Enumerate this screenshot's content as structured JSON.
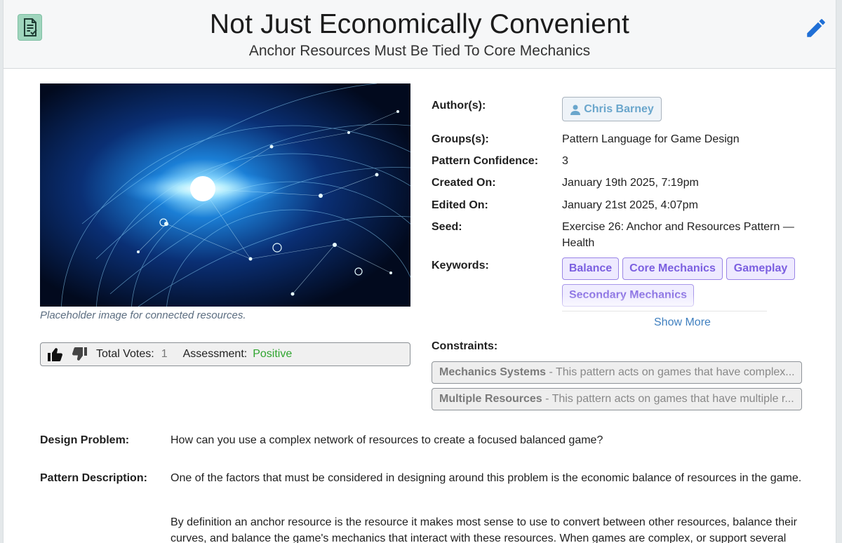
{
  "header": {
    "title": "Not Just Economically Convenient",
    "subtitle": "Anchor Resources Must Be Tied To Core Mechanics",
    "doc_icon": "document-check-icon",
    "edit_icon": "pencil-icon"
  },
  "image": {
    "caption": "Placeholder image for connected resources."
  },
  "votes": {
    "total_label": "Total Votes:",
    "total_value": "1",
    "assessment_label": "Assessment:",
    "assessment_value": "Positive"
  },
  "meta": {
    "authors_label": "Author(s):",
    "author_name": "Chris Barney",
    "groups_label": "Groups(s):",
    "groups_value": "Pattern Language for Game Design",
    "confidence_label": "Pattern Confidence:",
    "confidence_value": "3",
    "created_label": "Created On:",
    "created_value": "January 19th 2025, 7:19pm",
    "edited_label": "Edited On:",
    "edited_value": "January 21st 2025, 4:07pm",
    "seed_label": "Seed:",
    "seed_value": "Exercise 26: Anchor and Resources Pattern — Health",
    "keywords_label": "Keywords:",
    "keywords": [
      "Balance",
      "Core Mechanics",
      "Gameplay",
      "Secondary Mechanics"
    ],
    "show_more": "Show More",
    "constraints_label": "Constraints:",
    "constraints": [
      {
        "name": "Mechanics Systems",
        "desc": " - This pattern acts on games that have complex..."
      },
      {
        "name": "Multiple Resources",
        "desc": " - This pattern acts on games that have multiple r..."
      }
    ]
  },
  "body": {
    "problem_label": "Design Problem:",
    "problem_text": "How can you use a complex network of resources to create a focused balanced game?",
    "description_label": "Pattern Description:",
    "description_p1": "One of the factors that must be considered in designing around this problem is the economic balance of resources in the game.",
    "description_p2": "By definition an anchor resource is the resource it makes most sense to use to convert between other resources, balance their curves, and balance the game's mechanics that interact with these resources. When games are complex, or support several"
  },
  "colors": {
    "doc_button": "#9fd5bd",
    "edit_icon": "#1f6fd6",
    "keyword": "#7b5fe0",
    "positive": "#2fa52f",
    "link": "#3f7fbf"
  }
}
